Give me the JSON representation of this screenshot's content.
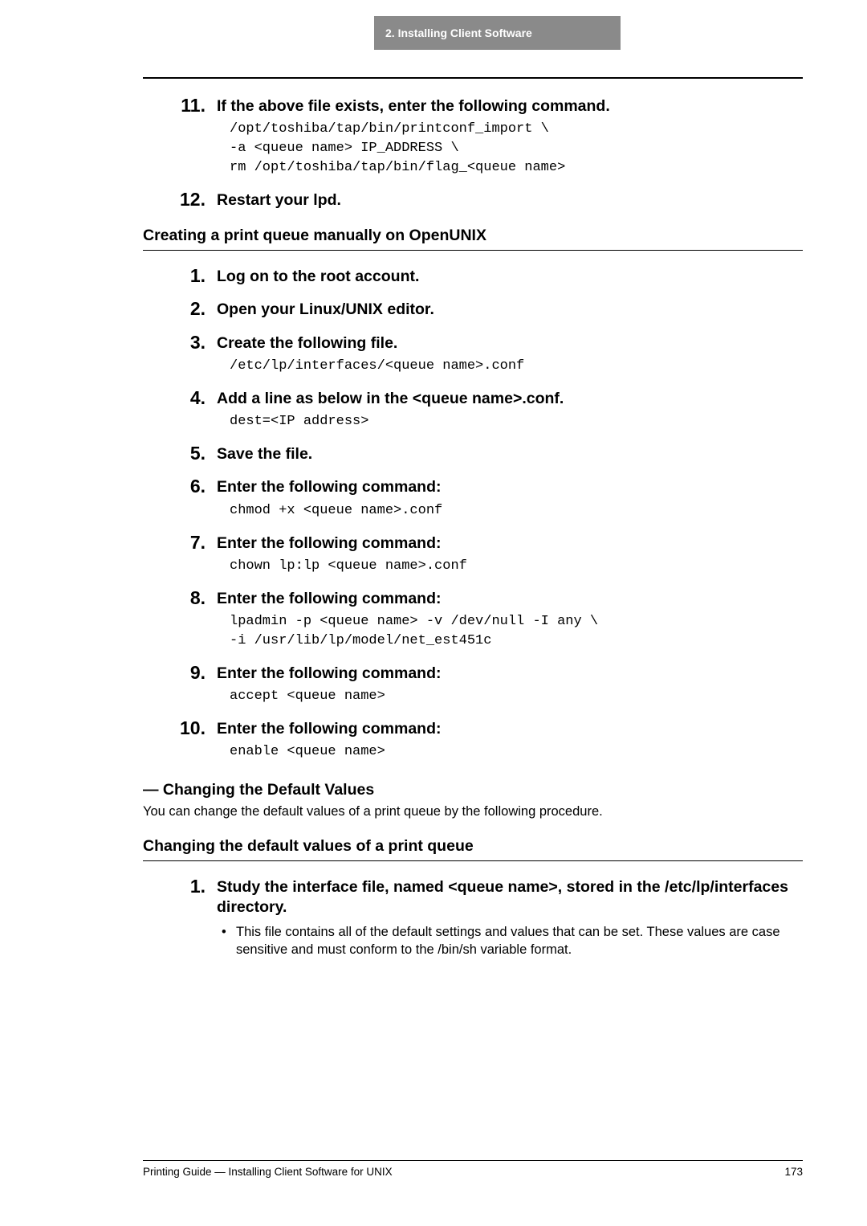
{
  "header": {
    "chapter": "2. Installing Client Software"
  },
  "topSteps": [
    {
      "num": "11.",
      "title": "If the above file exists, enter the following command.",
      "code": "/opt/toshiba/tap/bin/printconf_import \\\n-a <queue name> IP_ADDRESS \\\nrm /opt/toshiba/tap/bin/flag_<queue name>"
    },
    {
      "num": "12.",
      "title": "Restart your lpd."
    }
  ],
  "section1": {
    "heading": "Creating a print queue manually on OpenUNIX",
    "steps": [
      {
        "num": "1.",
        "title": "Log on to the root account."
      },
      {
        "num": "2.",
        "title": "Open your Linux/UNIX editor."
      },
      {
        "num": "3.",
        "title": "Create the following file.",
        "code": "/etc/lp/interfaces/<queue name>.conf"
      },
      {
        "num": "4.",
        "title": "Add a line as below in the <queue name>.conf.",
        "code": "dest=<IP address>"
      },
      {
        "num": "5.",
        "title": "Save the file."
      },
      {
        "num": "6.",
        "title": "Enter the following command:",
        "code": "chmod +x <queue name>.conf"
      },
      {
        "num": "7.",
        "title": "Enter the following command:",
        "code": "chown lp:lp <queue name>.conf"
      },
      {
        "num": "8.",
        "title": "Enter the following command:",
        "code": "lpadmin -p <queue name> -v /dev/null -I any \\\n-i /usr/lib/lp/model/net_est451c"
      },
      {
        "num": "9.",
        "title": "Enter the following command:",
        "code": "accept <queue name>"
      },
      {
        "num": "10.",
        "title": "Enter the following command:",
        "code": "enable <queue name>"
      }
    ]
  },
  "section2": {
    "heading": "— Changing the Default Values",
    "body": "You can change the default values of a print queue by the following procedure."
  },
  "section3": {
    "heading": "Changing the default values of a print queue",
    "steps": [
      {
        "num": "1.",
        "title": "Study the interface file, named <queue name>, stored in the /etc/lp/interfaces directory.",
        "bullet": "This file contains all of the default settings and values that can be set. These values are case sensitive and must conform to the /bin/sh variable format."
      }
    ]
  },
  "footer": {
    "left": "Printing Guide — Installing Client Software for UNIX",
    "right": "173"
  }
}
